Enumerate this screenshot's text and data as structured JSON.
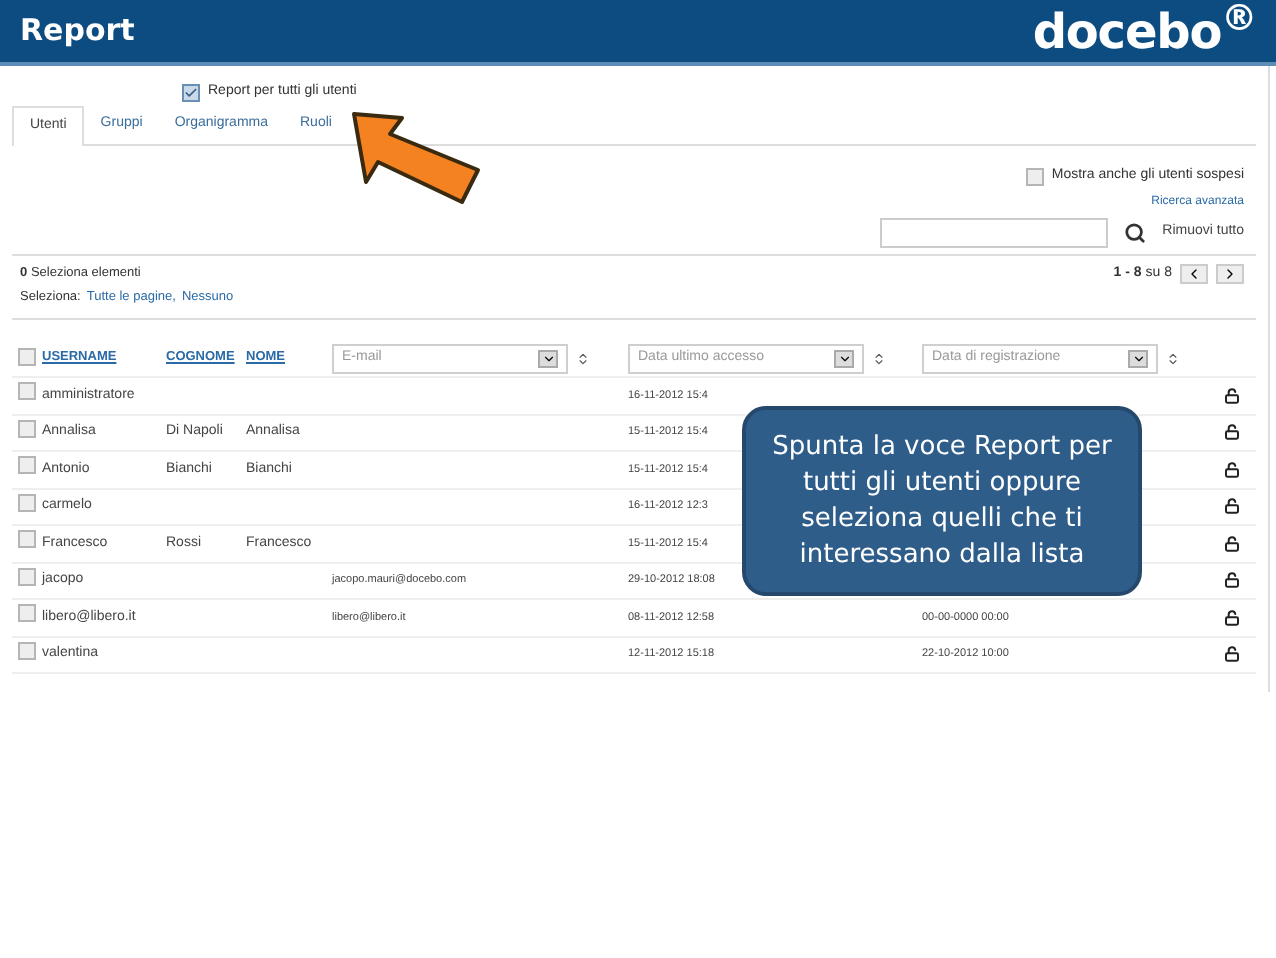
{
  "header": {
    "title": "Report",
    "logo": "docebo$^{®}$"
  },
  "report_all": {
    "label": "Report per tutti gli utenti",
    "checked": true
  },
  "tabs": [
    {
      "label": "Utenti",
      "selected": true
    },
    {
      "label": "Gruppi",
      "selected": false
    },
    {
      "label": "Organigramma",
      "selected": false
    },
    {
      "label": "Ruoli",
      "selected": false
    }
  ],
  "suspended": {
    "label": "Mostra anche gli utenti sospesi",
    "checked": false
  },
  "advanced_search": "Ricerca avanzata",
  "search": {
    "clear": "Rimuovi tutto"
  },
  "selection": {
    "count": "0",
    "label": "Seleziona elementi",
    "prefix": "Seleziona:",
    "all_pages": "Tutte le pagine,",
    "none": "Nessuno"
  },
  "pagination": {
    "range": "1 - 8",
    "total": "su 8"
  },
  "table": {
    "select_all_checked": false,
    "columns": [
      "USERNAME",
      "COGNOME",
      "NOME"
    ],
    "filters": [
      "E-mail",
      "Data ultimo accesso",
      "Data di registrazione"
    ],
    "rows": [
      {
        "username": "amministratore",
        "surname": "",
        "name": "",
        "email": "",
        "last_access": "16-11-2012 15:4",
        "registered": "",
        "checked": false
      },
      {
        "username": "Annalisa",
        "surname": "Di Napoli",
        "name": "Annalisa",
        "email": "",
        "last_access": "15-11-2012 15:4",
        "registered": "",
        "checked": false
      },
      {
        "username": "Antonio",
        "surname": "Bianchi",
        "name": "Bianchi",
        "email": "",
        "last_access": "15-11-2012 15:4",
        "registered": "",
        "checked": false
      },
      {
        "username": "carmelo",
        "surname": "",
        "name": "",
        "email": "",
        "last_access": "16-11-2012 12:3",
        "registered": "",
        "checked": false
      },
      {
        "username": "Francesco",
        "surname": "Rossi",
        "name": "Francesco",
        "email": "",
        "last_access": "15-11-2012 15:4",
        "registered": "",
        "checked": false
      },
      {
        "username": "jacopo",
        "surname": "",
        "name": "",
        "email": "jacopo.mauri@docebo.com",
        "last_access": "29-10-2012 18:08",
        "registered": "",
        "checked": false
      },
      {
        "username": "libero@libero.it",
        "surname": "",
        "name": "",
        "email": "libero@libero.it",
        "last_access": "08-11-2012 12:58",
        "registered": "00-00-0000 00:00",
        "checked": false
      },
      {
        "username": "valentina",
        "surname": "",
        "name": "",
        "email": "",
        "last_access": "12-11-2012 15:18",
        "registered": "22-10-2012 10:00",
        "checked": false
      }
    ]
  },
  "callout": "Spunta la voce Report per tutti gli utenti oppure seleziona quelli che ti interessano dalla lista"
}
